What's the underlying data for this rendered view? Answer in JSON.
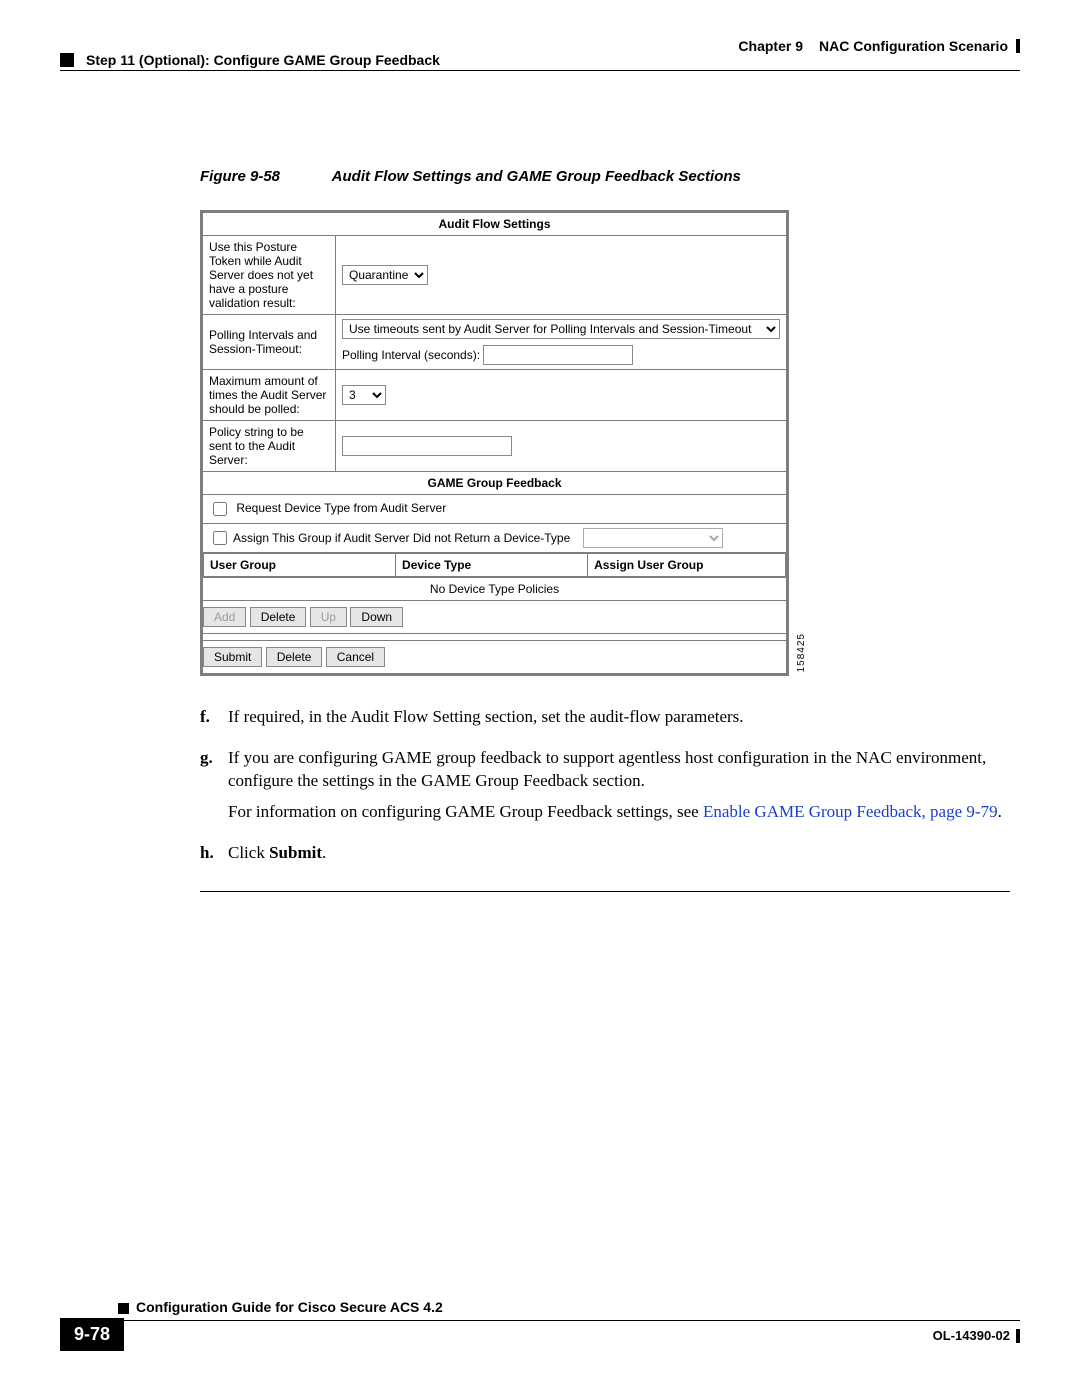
{
  "header": {
    "left": "Step 11 (Optional): Configure GAME Group Feedback",
    "right_prefix": "Chapter 9",
    "right_title": "NAC Configuration Scenario"
  },
  "figure": {
    "label": "Figure 9-58",
    "caption": "Audit Flow Settings and GAME Group Feedback Sections",
    "image_id": "158425"
  },
  "audit_flow": {
    "section_title": "Audit Flow Settings",
    "row1_label": "Use this Posture Token while Audit Server does not yet have a posture validation result:",
    "row1_select_value": "Quarantine",
    "row2_label": "Polling Intervals and Session-Timeout:",
    "row2_select_value": "Use timeouts sent by Audit Server for Polling Intervals and Session-Timeout",
    "row2_sub_label": "Polling Interval (seconds):",
    "row2_sub_value": "",
    "row3_label": "Maximum amount of times the Audit Server should be polled:",
    "row3_select_value": "3",
    "row4_label": "Policy string to be sent to the Audit Server:",
    "row4_value": ""
  },
  "game": {
    "section_title": "GAME Group Feedback",
    "chk1_label": "Request Device Type from Audit Server",
    "chk2_label": "Assign This Group if Audit Server Did not Return a Device-Type",
    "col_user_group": "User Group",
    "col_device_type": "Device Type",
    "col_assign": "Assign User Group",
    "empty_row": "No Device Type Policies",
    "btn_add": "Add",
    "btn_delete": "Delete",
    "btn_up": "Up",
    "btn_down": "Down",
    "btn_submit": "Submit",
    "btn_delete2": "Delete",
    "btn_cancel": "Cancel"
  },
  "steps": {
    "f": "If required, in the Audit Flow Setting section, set the audit-flow parameters.",
    "g_p1": "If you are configuring GAME group feedback to support agentless host configuration in the NAC environment, configure the settings in the GAME Group Feedback section.",
    "g_p2_a": "For information on configuring GAME Group Feedback settings, see ",
    "g_p2_link": "Enable GAME Group Feedback, page 9-79",
    "g_p2_b": ".",
    "h_a": "Click ",
    "h_b": "Submit",
    "h_c": "."
  },
  "footer": {
    "guide_title": "Configuration Guide for Cisco Secure ACS 4.2",
    "page_number": "9-78",
    "doc_id": "OL-14390-02"
  }
}
